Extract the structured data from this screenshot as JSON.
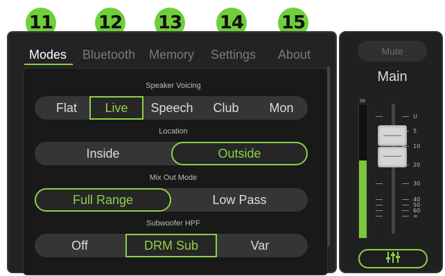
{
  "callouts": [
    "11",
    "12",
    "13",
    "14",
    "15"
  ],
  "tabs": [
    "Modes",
    "Bluetooth",
    "Memory",
    "Settings",
    "About"
  ],
  "active_tab": "Modes",
  "sections": {
    "voicing": {
      "title": "Speaker Voicing",
      "options": [
        "Flat",
        "Live",
        "Speech",
        "Club",
        "Mon"
      ],
      "selected": "Live"
    },
    "location": {
      "title": "Location",
      "options": [
        "Inside",
        "Outside"
      ],
      "selected": "Outside"
    },
    "mixout": {
      "title": "Mix Out Mode",
      "options": [
        "Full Range",
        "Low Pass"
      ],
      "selected": "Full Range"
    },
    "hpf": {
      "title": "Subwoofer HPF",
      "options": [
        "Off",
        "DRM Sub",
        "Var"
      ],
      "selected": "DRM Sub"
    }
  },
  "side": {
    "mute_label": "Mute",
    "channel_label": "Main",
    "scale": [
      "U",
      "5",
      "10",
      "20",
      "30",
      "40",
      "50",
      "60",
      "∞"
    ],
    "meter_level": 0.58,
    "button_icon": "fader-sliders-icon"
  },
  "colors": {
    "accent": "#8ed14a",
    "callout": "#6fcf3a",
    "panel": "#232323"
  }
}
